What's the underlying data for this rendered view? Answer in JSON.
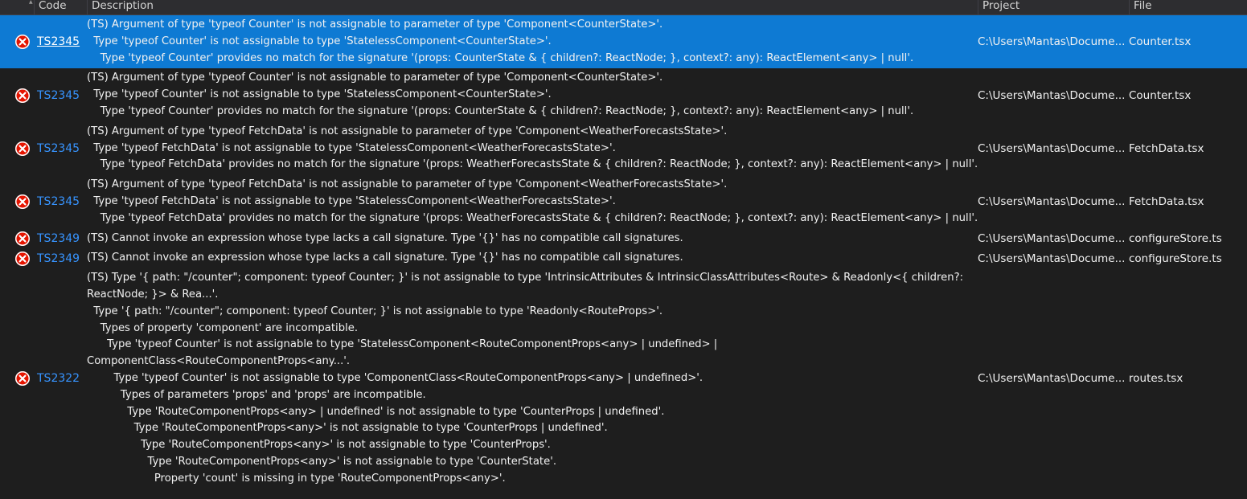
{
  "header": {
    "columns": [
      {
        "label": "Code"
      },
      {
        "label": "Description"
      },
      {
        "label": "Project"
      },
      {
        "label": "File"
      }
    ]
  },
  "rows": [
    {
      "code": "TS2345",
      "selected": true,
      "lines": [
        "(TS) Argument of type 'typeof Counter' is not assignable to parameter of type 'Component<CounterState>'.",
        "  Type 'typeof Counter' is not assignable to type 'StatelessComponent<CounterState>'.",
        "    Type 'typeof Counter' provides no match for the signature '(props: CounterState & { children?: ReactNode; }, context?: any): ReactElement<any> | null'."
      ],
      "project": "C:\\Users\\Mantas\\Docume...",
      "file": "Counter.tsx"
    },
    {
      "code": "TS2345",
      "selected": false,
      "lines": [
        "(TS) Argument of type 'typeof Counter' is not assignable to parameter of type 'Component<CounterState>'.",
        "  Type 'typeof Counter' is not assignable to type 'StatelessComponent<CounterState>'.",
        "    Type 'typeof Counter' provides no match for the signature '(props: CounterState & { children?: ReactNode; }, context?: any): ReactElement<any> | null'."
      ],
      "project": "C:\\Users\\Mantas\\Docume...",
      "file": "Counter.tsx"
    },
    {
      "code": "TS2345",
      "selected": false,
      "lines": [
        "(TS) Argument of type 'typeof FetchData' is not assignable to parameter of type 'Component<WeatherForecastsState>'.",
        "  Type 'typeof FetchData' is not assignable to type 'StatelessComponent<WeatherForecastsState>'.",
        "    Type 'typeof FetchData' provides no match for the signature '(props: WeatherForecastsState & { children?: ReactNode; }, context?: any): ReactElement<any> | null'."
      ],
      "project": "C:\\Users\\Mantas\\Docume...",
      "file": "FetchData.tsx"
    },
    {
      "code": "TS2345",
      "selected": false,
      "lines": [
        "(TS) Argument of type 'typeof FetchData' is not assignable to parameter of type 'Component<WeatherForecastsState>'.",
        "  Type 'typeof FetchData' is not assignable to type 'StatelessComponent<WeatherForecastsState>'.",
        "    Type 'typeof FetchData' provides no match for the signature '(props: WeatherForecastsState & { children?: ReactNode; }, context?: any): ReactElement<any> | null'."
      ],
      "project": "C:\\Users\\Mantas\\Docume...",
      "file": "FetchData.tsx"
    },
    {
      "code": "TS2349",
      "selected": false,
      "lines": [
        "(TS) Cannot invoke an expression whose type lacks a call signature. Type '{}' has no compatible call signatures."
      ],
      "project": "C:\\Users\\Mantas\\Docume...",
      "file": "configureStore.ts"
    },
    {
      "code": "TS2349",
      "selected": false,
      "lines": [
        "(TS) Cannot invoke an expression whose type lacks a call signature. Type '{}' has no compatible call signatures."
      ],
      "project": "C:\\Users\\Mantas\\Docume...",
      "file": "configureStore.ts"
    },
    {
      "code": "TS2322",
      "selected": false,
      "lines": [
        "(TS) Type '{ path: \"/counter\"; component: typeof Counter; }' is not assignable to type 'IntrinsicAttributes & IntrinsicClassAttributes<Route> & Readonly<{ children?:",
        "ReactNode; }> & Rea...'.",
        "  Type '{ path: \"/counter\"; component: typeof Counter; }' is not assignable to type 'Readonly<RouteProps>'.",
        "    Types of property 'component' are incompatible.",
        "      Type 'typeof Counter' is not assignable to type 'StatelessComponent<RouteComponentProps<any> | undefined> |",
        "ComponentClass<RouteComponentProps<any...'.",
        "        Type 'typeof Counter' is not assignable to type 'ComponentClass<RouteComponentProps<any> | undefined>'.",
        "          Types of parameters 'props' and 'props' are incompatible.",
        "            Type 'RouteComponentProps<any> | undefined' is not assignable to type 'CounterProps | undefined'.",
        "              Type 'RouteComponentProps<any>' is not assignable to type 'CounterProps | undefined'.",
        "                Type 'RouteComponentProps<any>' is not assignable to type 'CounterProps'.",
        "                  Type 'RouteComponentProps<any>' is not assignable to type 'CounterState'.",
        "                    Property 'count' is missing in type 'RouteComponentProps<any>'."
      ],
      "project": "C:\\Users\\Mantas\\Docume...",
      "file": "routes.tsx"
    }
  ],
  "colors": {
    "background": "#1e1e1e",
    "header_background": "#2d2d30",
    "selection": "#0e7ad3",
    "link": "#3794ff",
    "error_icon": "#e51400"
  },
  "icons": {
    "row_icon": "error-icon"
  }
}
